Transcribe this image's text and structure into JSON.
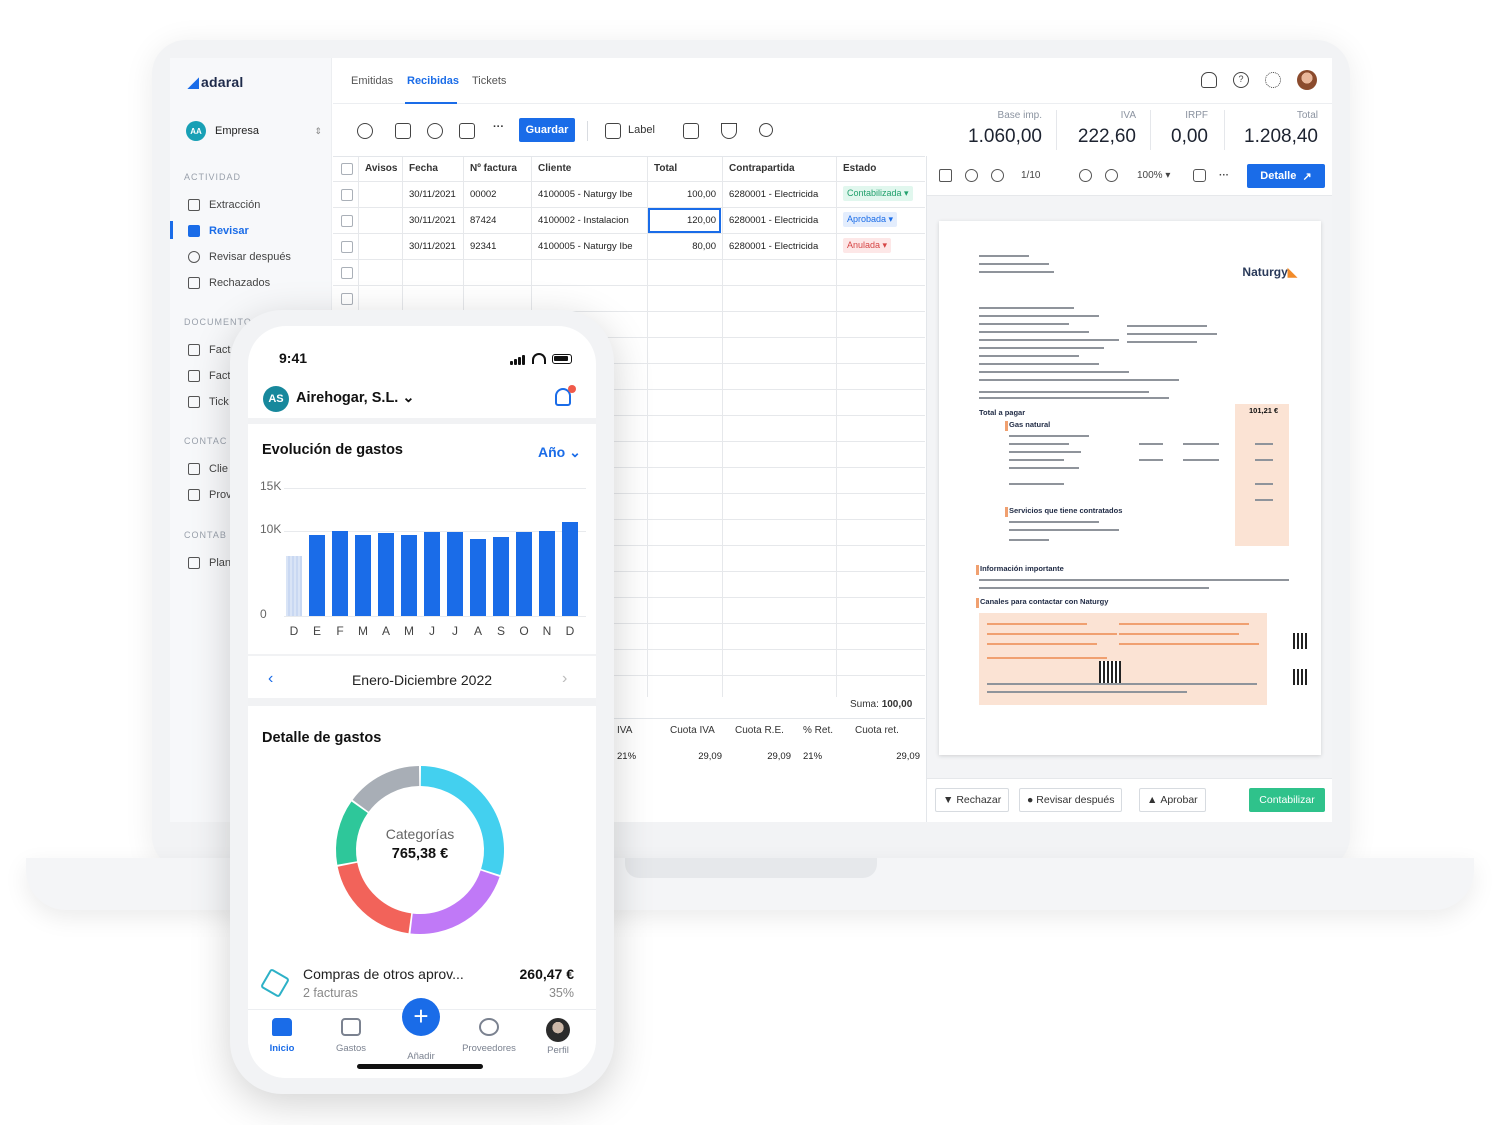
{
  "desktop": {
    "app": {
      "logo": "adaral",
      "company_initials": "AA",
      "company": "Empresa"
    },
    "sidebar": {
      "sections": [
        {
          "label": "ACTIVIDAD",
          "items": [
            "Extracción",
            "Revisar",
            "Revisar después",
            "Rechazados"
          ]
        },
        {
          "label": "DOCUMENTO",
          "items": [
            "Fact",
            "Fact",
            "Tick"
          ]
        },
        {
          "label": "CONTAC",
          "items": [
            "Clie",
            "Prov"
          ]
        },
        {
          "label": "CONTAB",
          "items": [
            "Plan"
          ]
        }
      ],
      "active_item": "Revisar"
    },
    "tabs": [
      "Emitidas",
      "Recibidas",
      "Tickets"
    ],
    "active_tab": "Recibidas",
    "toolbar": {
      "save_label": "Guardar",
      "label_filter": "Label",
      "more": "···"
    },
    "totals": [
      {
        "label": "Base imp.",
        "value": "1.060,00"
      },
      {
        "label": "IVA",
        "value": "222,60"
      },
      {
        "label": "IRPF",
        "value": "0,00"
      },
      {
        "label": "Total",
        "value": "1.208,40"
      }
    ],
    "table": {
      "headers": [
        "Avisos",
        "Fecha",
        "Nº factura",
        "Cliente",
        "Total",
        "Contrapartida",
        "Estado"
      ],
      "rows": [
        {
          "fecha": "30/11/2021",
          "factura": "00002",
          "cliente": "4100005 - Naturgy Ibe",
          "total": "100,00",
          "contrapartida": "6280001 - Electricida",
          "estado": "Contabilizada"
        },
        {
          "fecha": "30/11/2021",
          "factura": "87424",
          "cliente": "4100002 - Instalacion",
          "total": "120,00",
          "contrapartida": "6280001 - Electricida",
          "estado": "Aprobada"
        },
        {
          "fecha": "30/11/2021",
          "factura": "92341",
          "cliente": "4100005 - Naturgy Ibe",
          "total": "80,00",
          "contrapartida": "6280001 - Electricida",
          "estado": "Anulada"
        }
      ],
      "sum_label": "Suma:",
      "sum_value": "100,00"
    },
    "tax_table": {
      "headers": [
        "IVA",
        "Cuota IVA",
        "Cuota R.E.",
        "% Ret.",
        "Cuota ret."
      ],
      "row": [
        "21%",
        "29,09",
        "29,09",
        "21%",
        "29,09"
      ]
    },
    "viewer": {
      "page_indicator": "1/10",
      "zoom": "100%",
      "detail_button": "Detalle",
      "document": {
        "brand": "Naturgy",
        "total_label": "Total a pagar",
        "total_amount": "101,21 €",
        "section_gas": "Gas natural",
        "section_services": "Servicios que tiene contratados",
        "section_info": "Información importante",
        "section_channels": "Canales para contactar con Naturgy"
      },
      "actions": {
        "reject": "Rechazar",
        "review_later": "Revisar después",
        "approve": "Aprobar",
        "post": "Contabilizar"
      }
    }
  },
  "mobile": {
    "time": "9:41",
    "company_initials": "AS",
    "company": "Airehogar, S.L.",
    "chart_card": {
      "title": "Evolución de gastos",
      "period_selector": "Año"
    },
    "period": "Enero-Diciembre 2022",
    "detail_card": {
      "title": "Detalle de gastos",
      "center_label": "Categorías",
      "center_value": "765,38 €"
    },
    "category": {
      "name": "Compras de otros aprov...",
      "invoices": "2 facturas",
      "amount": "260,47 €",
      "percent": "35%"
    },
    "nav": [
      "Inicio",
      "Gastos",
      "Añadir",
      "Proveedores",
      "Perfil"
    ],
    "active_nav": "Inicio"
  },
  "chart_data": [
    {
      "type": "bar",
      "title": "Evolución de gastos",
      "categories": [
        "D",
        "E",
        "F",
        "M",
        "A",
        "M",
        "J",
        "J",
        "A",
        "S",
        "O",
        "N",
        "D"
      ],
      "values": [
        7000,
        9500,
        10000,
        9500,
        9700,
        9500,
        9800,
        9800,
        9000,
        9200,
        9900,
        10000,
        11000
      ],
      "y_ticks": [
        "0",
        "10K",
        "15K"
      ],
      "ylim": [
        0,
        15000
      ],
      "grid": true,
      "note_first_bar": "previous year, shown faded"
    },
    {
      "type": "pie",
      "title": "Detalle de gastos",
      "center_text": "Categorías 765,38 €",
      "values": [
        0.3,
        0.22,
        0.2,
        0.13,
        0.15
      ],
      "colors": [
        "#43d0ef",
        "#c079f7",
        "#f2635a",
        "#2ec79a",
        "#a8aeb6"
      ]
    }
  ]
}
